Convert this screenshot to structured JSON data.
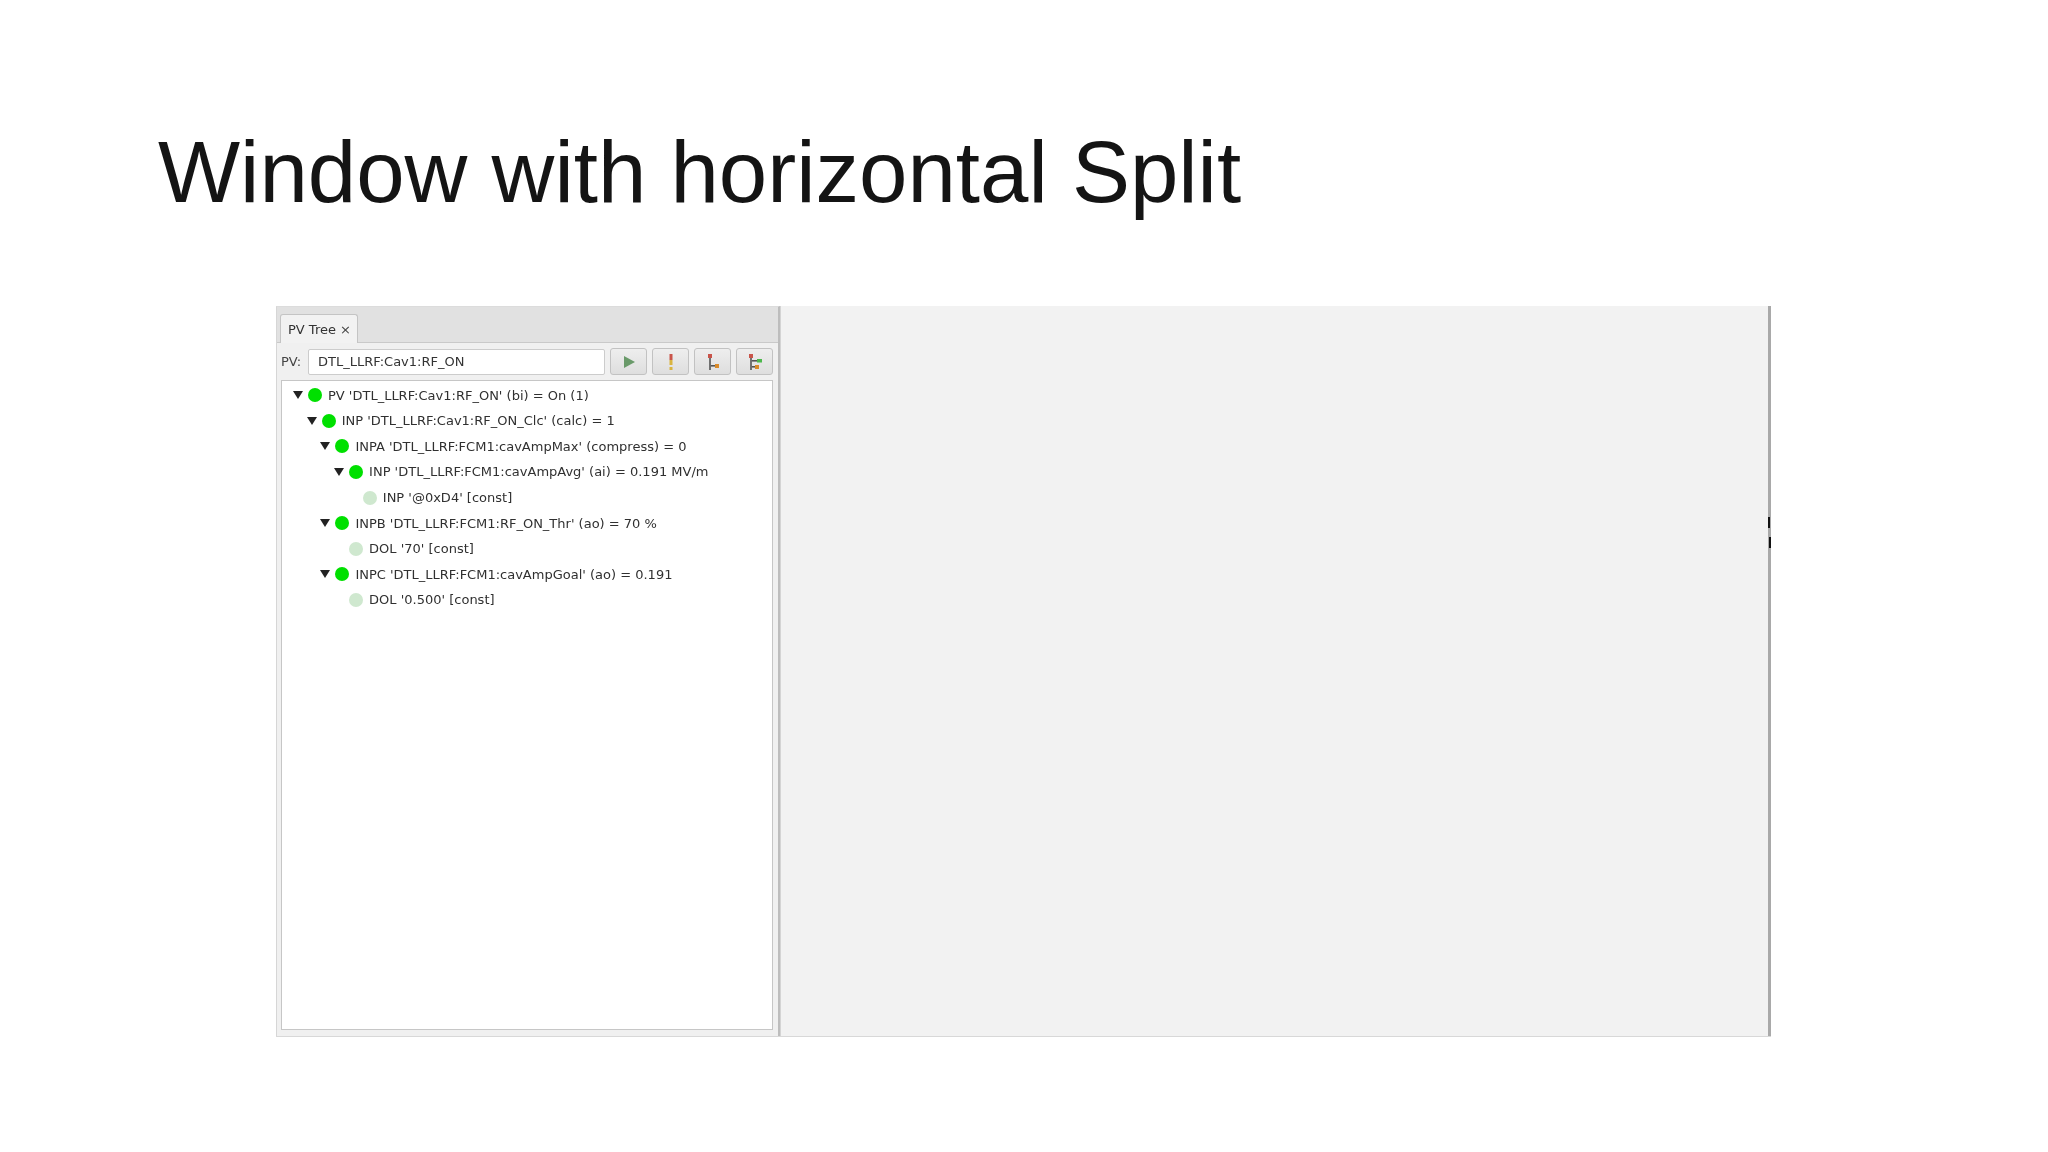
{
  "slide": {
    "title": "Window with horizontal Split"
  },
  "window": {
    "tabs": [
      {
        "label": "PV Tree",
        "close": "×",
        "selected": true
      }
    ],
    "pv_field": {
      "label": "PV:",
      "value": "DTL_LLRF:Cav1:RF_ON"
    },
    "toolbar": [
      {
        "kind": "play"
      },
      {
        "kind": "alert"
      },
      {
        "kind": "collapse"
      },
      {
        "kind": "expand"
      }
    ],
    "tree": [
      {
        "label": "PV 'DTL_LLRF:Cav1:RF_ON' (bi) = On (1)",
        "color": "#00e000",
        "expanded": true,
        "children": [
          {
            "label": "INP 'DTL_LLRF:Cav1:RF_ON_Clc' (calc) = 1",
            "color": "#00e000",
            "expanded": true,
            "children": [
              {
                "label": "INPA 'DTL_LLRF:FCM1:cavAmpMax' (compress) = 0",
                "color": "#00e000",
                "expanded": true,
                "children": [
                  {
                    "label": "INP 'DTL_LLRF:FCM1:cavAmpAvg' (ai) = 0.191 MV/m",
                    "color": "#00e000",
                    "expanded": true,
                    "children": [
                      {
                        "label": "INP '@0xD4' [const]",
                        "color": "#cfe8cf"
                      }
                    ]
                  }
                ]
              },
              {
                "label": "INPB 'DTL_LLRF:FCM1:RF_ON_Thr' (ao) = 70 %",
                "color": "#00e000",
                "expanded": true,
                "children": [
                  {
                    "label": "DOL '70' [const]",
                    "color": "#cfe8cf"
                  }
                ]
              },
              {
                "label": "INPC 'DTL_LLRF:FCM1:cavAmpGoal' (ao) = 0.191",
                "color": "#00e000",
                "expanded": true,
                "children": [
                  {
                    "label": "DOL '0.500' [const]",
                    "color": "#cfe8cf"
                  }
                ]
              }
            ]
          }
        ]
      }
    ]
  }
}
